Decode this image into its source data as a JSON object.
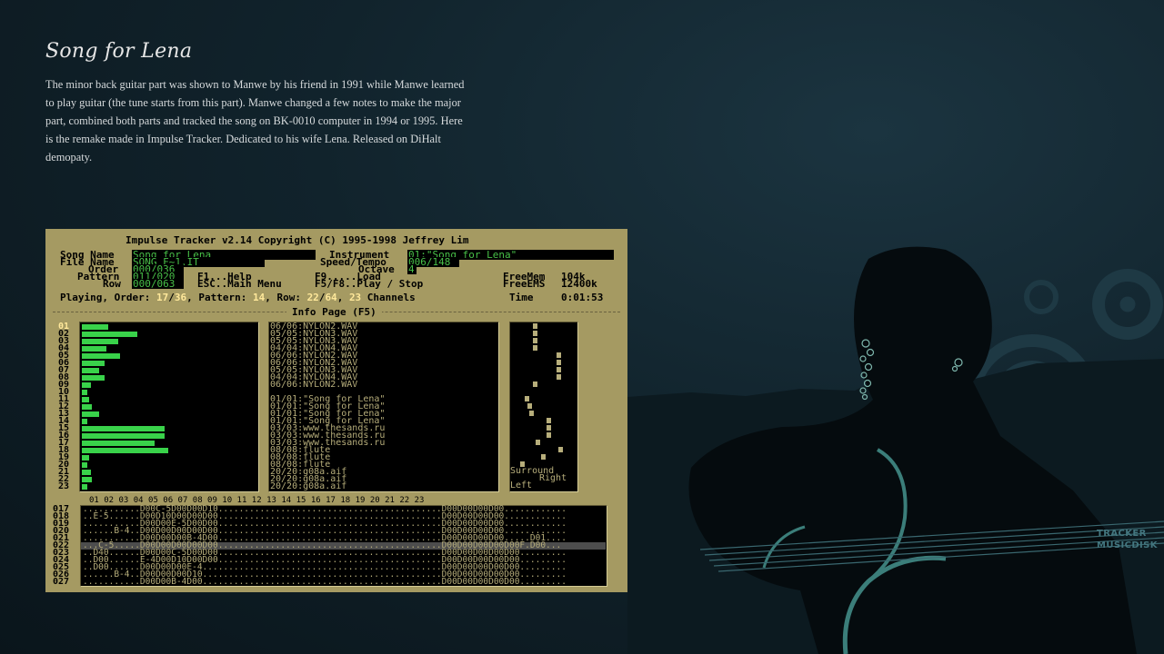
{
  "page": {
    "title": "Song for Lena",
    "description": "The minor back guitar part was shown to Manwe by his friend in 1991 while Manwe learned to play guitar (the tune starts from this part). Manwe changed a few notes to make the major part, combined both parts and tracked the song on BK-0010 computer in 1994 or 1995. Here is the remake made in Impulse Tracker. Dedicated to his wife Lena. Released on DiHalt demopaty.",
    "badge_line1": "TRACKER",
    "badge_line2": "MUSICDISK"
  },
  "tracker": {
    "header": "Impulse Tracker v2.14 Copyright (C) 1995-1998 Jeffrey Lim",
    "labels": {
      "song_name": "Song Name",
      "file_name": "File Name",
      "order": "Order",
      "pattern": "Pattern",
      "row": "Row",
      "instrument": "Instrument",
      "speed_tempo": "Speed/Tempo",
      "octave": "Octave",
      "help": "F1...Help",
      "main_menu": "ESC..Main Menu",
      "load": "F9.....Load",
      "play_stop": "F5/F8..Play / Stop",
      "freemem": "FreeMem",
      "freeems": "FreeEMS",
      "time": "Time",
      "info_page": "Info Page (F5)",
      "surround": "Surround",
      "right": "Right",
      "left": "Left"
    },
    "values": {
      "song_name": "Song for Lena",
      "file_name": "SONG_F~1.IT",
      "order": "000/036",
      "pattern": "011/020",
      "row": "000/063",
      "instrument": "01:\"Song for Lena\"",
      "speed_tempo": "006/148",
      "octave": "4",
      "freemem": "104k",
      "freeems": "12400k",
      "time": "0:01:53"
    },
    "status": {
      "playing": "Playing, Order: ",
      "order_cur": "17",
      "slash1": "/",
      "order_total": "36",
      "pattern_lbl": ", Pattern: ",
      "pattern_cur": "14",
      "row_lbl": ", Row: ",
      "row_cur": "22",
      "slash2": "/",
      "row_total": "64",
      "comma": ", ",
      "channels_cur": "23",
      "channels_lbl": " Channels"
    },
    "channel_numbers": [
      "01",
      "02",
      "03",
      "04",
      "05",
      "06",
      "07",
      "08",
      "09",
      "10",
      "11",
      "12",
      "13",
      "14",
      "15",
      "16",
      "17",
      "18",
      "19",
      "20",
      "21",
      "22",
      "23"
    ],
    "channel_levels": [
      0.15,
      0.32,
      0.21,
      0.14,
      0.22,
      0.13,
      0.1,
      0.13,
      0.05,
      0.03,
      0.04,
      0.06,
      0.1,
      0.03,
      0.48,
      0.48,
      0.42,
      0.5,
      0.04,
      0.03,
      0.05,
      0.06,
      0.03
    ],
    "samples": [
      "06/06:NYLON2.WAV",
      "05/05:NYLON3.WAV",
      "05/05:NYLON3.WAV",
      "04/04:NYLON4.WAV",
      "06/06:NYLON2.WAV",
      "06/06:NYLON2.WAV",
      "05/05:NYLON3.WAV",
      "04/04:NYLON4.WAV",
      "06/06:NYLON2.WAV",
      "",
      "01/01:\"Song for Lena\"",
      "01/01:\"Song for Lena\"",
      "01/01:\"Song for Lena\"",
      "01/01:\"Song for Lena\"",
      "03/03:www.thesands.ru",
      "03/03:www.thesands.ru",
      "03/03:www.thesands.ru",
      "08/08:flute",
      "08/08:flute",
      "08/08:flute",
      "20/20:g08a.aif",
      "20/20:g08a.aif",
      "20/20:g08a.aif"
    ],
    "pattern_header": "01 02 03 04 05 06 07 08 09 10 11 12 13 14 15 16 17 18 19 20 21 22 23",
    "pattern_row_numbers": [
      "017",
      "018",
      "019",
      "020",
      "021",
      "022",
      "023",
      "024",
      "025",
      "026",
      "027"
    ],
    "pattern_rows": [
      "...........D00C-5D00D00D10...........................................D00D00D00D00............",
      "..E-5......D00D10D00D00D00...........................................D00D00D00D00............",
      "...........D00D00E-5D00D00...........................................D00D00D00D00............",
      "......B-4..D00D00D00D00D00...........................................D00D00D00D00............",
      "...........D00D00D00B-4D00...........................................D00D00D00D00.....D01....",
      "...C-5.....D00D00D00D00D00...........................................D00D00D00D00D00F.D00...",
      "..D40......D00D00C-5D00D00...........................................D00D00D00D00D00.........",
      "..D00......E-4D00D10D00D00...........................................D00D00D00D00D00.........",
      "..D00......D00D00D00E-4..............................................D00D00D00D00D00.........",
      "......B-4..D00D00D00D10..............................................D00D00D00D00D00.........",
      "...........D00D00B-4D00..............................................D00D00D00D00D00........."
    ]
  }
}
